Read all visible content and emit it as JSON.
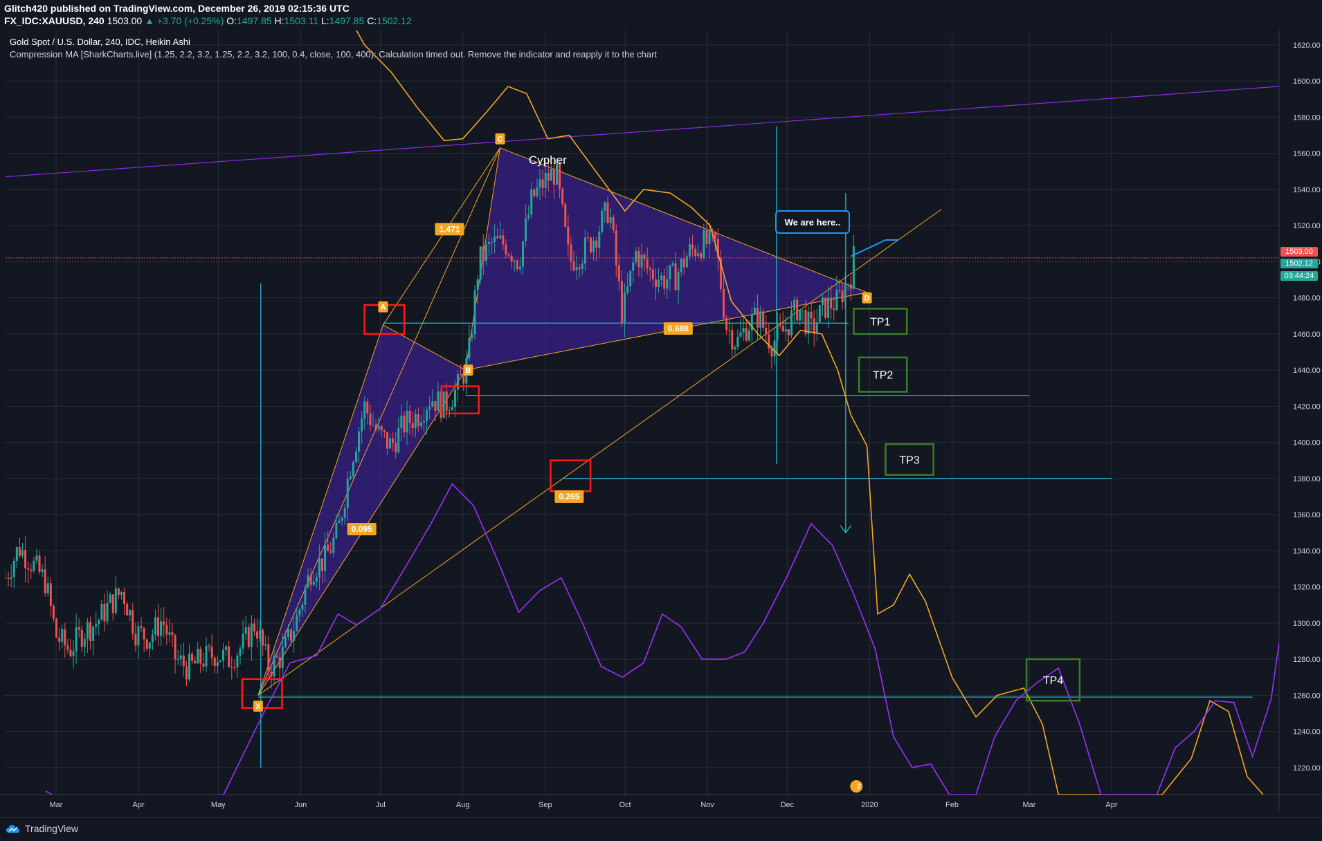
{
  "header": {
    "publisher_line": "Glitch420 published on TradingView.com, December 26, 2019 02:15:36 UTC",
    "symbol": "FX_IDC:XAUUSD, 240",
    "last": "1503.00",
    "change": "▲ +3.70 (+0.25%)",
    "o_label": "O:",
    "o_value": "1497.85",
    "h_label": "H:",
    "h_value": "1503.11",
    "l_label": "L:",
    "l_value": "1497.85",
    "c_label": "C:",
    "c_value": "1502.12"
  },
  "legend": {
    "title": "Gold Spot / U.S. Dollar, 240, IDC, Heikin Ashi",
    "indicator": "Compression MA [SharkCharts.live] (1.25, 2.2, 3.2, 1.25, 2.2, 3.2, 100, 0.4, close, 100, 400): Calculation timed out. Remove the indicator and reapply it to the chart"
  },
  "annotations": {
    "pattern_name": "Cypher",
    "callout": "We are here..",
    "point_labels": [
      "A",
      "B",
      "C",
      "D",
      "X"
    ],
    "ratio_labels": [
      "1.471",
      "0.688",
      "0.095",
      "0.265"
    ],
    "targets": [
      "TP1",
      "TP2",
      "TP3",
      "TP4"
    ],
    "event_badge": "2"
  },
  "price_tags": {
    "last": "1503.00",
    "close": "1502.12",
    "countdown": "03:44:24"
  },
  "footer": {
    "brand": "TradingView"
  },
  "colors": {
    "background": "#131722",
    "grid": "#2a2e39",
    "up": "#26a69a",
    "down": "#ef5350",
    "pattern_fill": "#3a1f8c",
    "orange": "#f5a623",
    "purple": "#8a2be2",
    "cyan": "#26c6da",
    "red_box": "#ff1a1a",
    "target_box": "#3b7d2a"
  },
  "chart_data": {
    "type": "line",
    "title": "Gold Spot / U.S. Dollar, 240, IDC, Heikin Ashi",
    "xlabel": "",
    "ylabel": "",
    "x_ticks": [
      "Mar",
      "Apr",
      "May",
      "Jun",
      "Jul",
      "Aug",
      "Sep",
      "Oct",
      "Nov",
      "Dec",
      "2020",
      "Feb",
      "Mar",
      "Apr"
    ],
    "x_tick_dates": [
      "2019-03-01",
      "2019-04-01",
      "2019-05-01",
      "2019-06-01",
      "2019-07-01",
      "2019-08-01",
      "2019-09-01",
      "2019-10-01",
      "2019-11-01",
      "2019-12-01",
      "2020-01-01",
      "2020-02-01",
      "2020-03-01",
      "2020-04-01"
    ],
    "y_ticks": [
      1220,
      1240,
      1260,
      1280,
      1300,
      1320,
      1340,
      1360,
      1380,
      1400,
      1420,
      1440,
      1460,
      1480,
      1500,
      1520,
      1540,
      1560,
      1580,
      1600,
      1620
    ],
    "xlim": [
      "2019-02-10",
      "2020-06-03"
    ],
    "ylim": [
      1205,
      1628
    ],
    "grid": true,
    "series": [
      {
        "kind": "price",
        "points": [
          [
            "2019-02-10",
            1325
          ],
          [
            "2019-02-15",
            1342
          ],
          [
            "2019-02-20",
            1333
          ],
          [
            "2019-02-25",
            1323
          ],
          [
            "2019-03-01",
            1293
          ],
          [
            "2019-03-06",
            1285
          ],
          [
            "2019-03-11",
            1295
          ],
          [
            "2019-03-16",
            1300
          ],
          [
            "2019-03-21",
            1310
          ],
          [
            "2019-03-26",
            1318
          ],
          [
            "2019-03-31",
            1295
          ],
          [
            "2019-04-05",
            1292
          ],
          [
            "2019-04-10",
            1302
          ],
          [
            "2019-04-15",
            1280
          ],
          [
            "2019-04-20",
            1275
          ],
          [
            "2019-04-25",
            1280
          ],
          [
            "2019-04-30",
            1283
          ],
          [
            "2019-05-05",
            1280
          ],
          [
            "2019-05-10",
            1287
          ],
          [
            "2019-05-15",
            1300
          ],
          [
            "2019-05-20",
            1275
          ],
          [
            "2019-05-25",
            1282
          ],
          [
            "2019-05-30",
            1300
          ],
          [
            "2019-06-05",
            1330
          ],
          [
            "2019-06-10",
            1335
          ],
          [
            "2019-06-15",
            1350
          ],
          [
            "2019-06-20",
            1390
          ],
          [
            "2019-06-25",
            1420
          ],
          [
            "2019-06-30",
            1405
          ],
          [
            "2019-07-05",
            1398
          ],
          [
            "2019-07-10",
            1410
          ],
          [
            "2019-07-15",
            1415
          ],
          [
            "2019-07-20",
            1425
          ],
          [
            "2019-07-25",
            1420
          ],
          [
            "2019-07-30",
            1430
          ],
          [
            "2019-08-03",
            1445
          ],
          [
            "2019-08-07",
            1500
          ],
          [
            "2019-08-12",
            1510
          ],
          [
            "2019-08-17",
            1510
          ],
          [
            "2019-08-22",
            1500
          ],
          [
            "2019-08-27",
            1535
          ],
          [
            "2019-09-01",
            1545
          ],
          [
            "2019-09-05",
            1550
          ],
          [
            "2019-09-10",
            1500
          ],
          [
            "2019-09-15",
            1505
          ],
          [
            "2019-09-20",
            1515
          ],
          [
            "2019-09-25",
            1530
          ],
          [
            "2019-09-30",
            1470
          ],
          [
            "2019-10-05",
            1505
          ],
          [
            "2019-10-10",
            1495
          ],
          [
            "2019-10-15",
            1490
          ],
          [
            "2019-10-20",
            1492
          ],
          [
            "2019-10-25",
            1505
          ],
          [
            "2019-10-30",
            1510
          ],
          [
            "2019-11-04",
            1510
          ],
          [
            "2019-11-08",
            1465
          ],
          [
            "2019-11-12",
            1455
          ],
          [
            "2019-11-16",
            1465
          ],
          [
            "2019-11-20",
            1470
          ],
          [
            "2019-11-25",
            1455
          ],
          [
            "2019-11-30",
            1462
          ],
          [
            "2019-12-05",
            1475
          ],
          [
            "2019-12-10",
            1462
          ],
          [
            "2019-12-15",
            1475
          ],
          [
            "2019-12-20",
            1478
          ],
          [
            "2019-12-25",
            1493
          ],
          [
            "2019-12-26",
            1502.12
          ]
        ]
      },
      {
        "kind": "orange-ma",
        "points": [
          [
            "2019-06-10",
            1660
          ],
          [
            "2019-06-25",
            1620
          ],
          [
            "2019-07-05",
            1605
          ],
          [
            "2019-07-15",
            1585
          ],
          [
            "2019-07-25",
            1567
          ],
          [
            "2019-08-01",
            1568
          ],
          [
            "2019-08-10",
            1583
          ],
          [
            "2019-08-18",
            1597
          ],
          [
            "2019-08-25",
            1593
          ],
          [
            "2019-09-02",
            1568
          ],
          [
            "2019-09-10",
            1570
          ],
          [
            "2019-09-20",
            1550
          ],
          [
            "2019-10-01",
            1528
          ],
          [
            "2019-10-08",
            1540
          ],
          [
            "2019-10-18",
            1538
          ],
          [
            "2019-10-26",
            1530
          ],
          [
            "2019-11-02",
            1520
          ],
          [
            "2019-11-10",
            1478
          ],
          [
            "2019-11-20",
            1460
          ],
          [
            "2019-11-28",
            1448
          ],
          [
            "2019-12-06",
            1462
          ],
          [
            "2019-12-14",
            1460
          ],
          [
            "2019-12-20",
            1440
          ],
          [
            "2019-12-25",
            1415
          ],
          [
            "2019-12-31",
            1398
          ],
          [
            "2020-01-04",
            1305
          ],
          [
            "2020-01-10",
            1310
          ],
          [
            "2020-01-16",
            1327
          ],
          [
            "2020-01-22",
            1312
          ],
          [
            "2020-02-01",
            1270
          ],
          [
            "2020-02-10",
            1248
          ],
          [
            "2020-02-18",
            1260
          ],
          [
            "2020-02-28",
            1264
          ],
          [
            "2020-03-06",
            1244
          ],
          [
            "2020-03-12",
            1205
          ],
          [
            "2020-04-20",
            1205
          ],
          [
            "2020-05-01",
            1225
          ],
          [
            "2020-05-08",
            1257
          ],
          [
            "2020-05-15",
            1251
          ],
          [
            "2020-05-22",
            1215
          ],
          [
            "2020-05-28",
            1205
          ]
        ]
      },
      {
        "kind": "purple-ma",
        "points": [
          [
            "2019-02-25",
            1207
          ],
          [
            "2019-03-06",
            1200
          ],
          [
            "2019-05-03",
            1205
          ],
          [
            "2019-05-18",
            1250
          ],
          [
            "2019-05-28",
            1278
          ],
          [
            "2019-06-07",
            1282
          ],
          [
            "2019-06-15",
            1305
          ],
          [
            "2019-06-22",
            1299
          ],
          [
            "2019-07-01",
            1308
          ],
          [
            "2019-07-10",
            1330
          ],
          [
            "2019-07-20",
            1355
          ],
          [
            "2019-07-28",
            1377
          ],
          [
            "2019-08-05",
            1365
          ],
          [
            "2019-08-14",
            1335
          ],
          [
            "2019-08-22",
            1306
          ],
          [
            "2019-08-30",
            1318
          ],
          [
            "2019-09-07",
            1325
          ],
          [
            "2019-09-15",
            1300
          ],
          [
            "2019-09-22",
            1276
          ],
          [
            "2019-09-30",
            1270
          ],
          [
            "2019-10-08",
            1278
          ],
          [
            "2019-10-15",
            1305
          ],
          [
            "2019-10-22",
            1298
          ],
          [
            "2019-10-30",
            1280
          ],
          [
            "2019-11-08",
            1280
          ],
          [
            "2019-11-15",
            1284
          ],
          [
            "2019-11-22",
            1300
          ],
          [
            "2019-12-01",
            1326
          ],
          [
            "2019-12-10",
            1355
          ],
          [
            "2019-12-18",
            1343
          ],
          [
            "2019-12-26",
            1316
          ],
          [
            "2020-01-03",
            1286
          ],
          [
            "2020-01-10",
            1237
          ],
          [
            "2020-01-17",
            1220
          ],
          [
            "2020-01-24",
            1222
          ],
          [
            "2020-01-31",
            1205
          ],
          [
            "2020-02-10",
            1205
          ],
          [
            "2020-02-17",
            1237
          ],
          [
            "2020-02-25",
            1257
          ],
          [
            "2020-03-04",
            1267
          ],
          [
            "2020-03-12",
            1275
          ],
          [
            "2020-03-20",
            1244
          ],
          [
            "2020-03-28",
            1205
          ],
          [
            "2020-04-18",
            1205
          ],
          [
            "2020-04-25",
            1231
          ],
          [
            "2020-05-02",
            1240
          ],
          [
            "2020-05-10",
            1257
          ],
          [
            "2020-05-17",
            1256
          ],
          [
            "2020-05-24",
            1226
          ],
          [
            "2020-05-31",
            1258
          ],
          [
            "2020-06-03",
            1289
          ]
        ]
      }
    ],
    "harmonic": {
      "X": [
        "2019-05-16",
        1260
      ],
      "A": [
        "2019-07-02",
        1465
      ],
      "B": [
        "2019-08-02",
        1440
      ],
      "C": [
        "2019-08-15",
        1563
      ],
      "D": [
        "2019-12-31",
        1483
      ]
    },
    "levels": [
      1466,
      1426,
      1380,
      1259
    ]
  }
}
